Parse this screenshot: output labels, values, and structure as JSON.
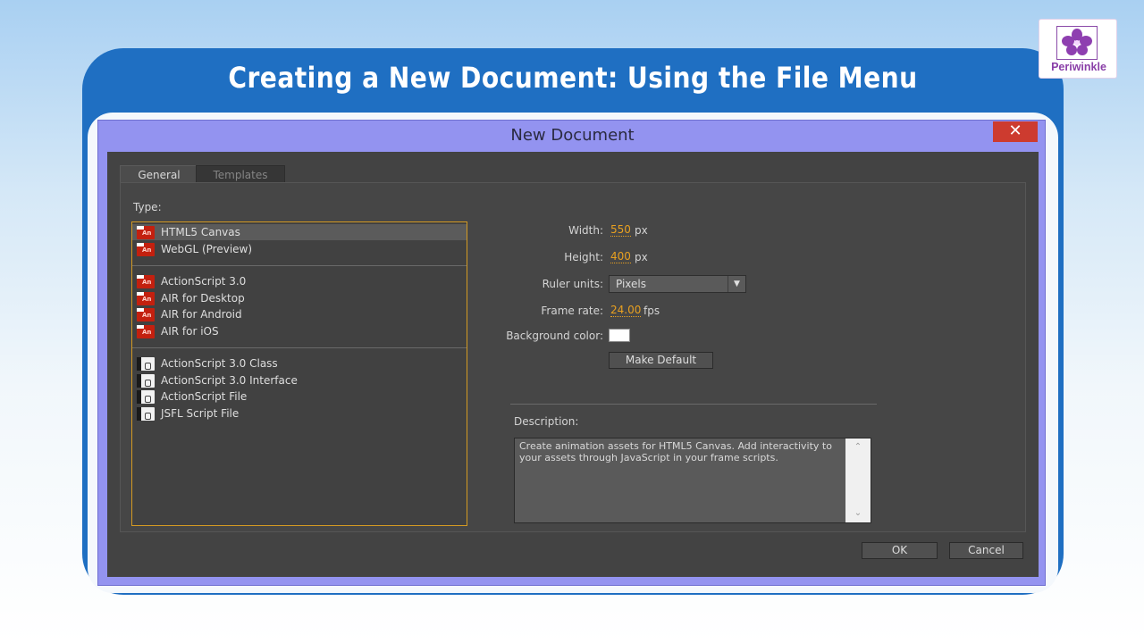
{
  "slide": {
    "title": "Creating a New Document: Using the File Menu",
    "logo_text": "Periwinkle"
  },
  "dialog": {
    "title": "New Document",
    "close_glyph": "✕",
    "tabs": [
      {
        "label": "General",
        "active": true
      },
      {
        "label": "Templates",
        "active": false
      }
    ],
    "type_label": "Type:",
    "types": [
      {
        "label": "HTML5 Canvas",
        "icon": "animate-doc-icon",
        "selected": true
      },
      {
        "label": "WebGL (Preview)",
        "icon": "animate-doc-icon"
      },
      {
        "label": "ActionScript 3.0",
        "icon": "animate-doc-icon"
      },
      {
        "label": "AIR for Desktop",
        "icon": "animate-doc-icon"
      },
      {
        "label": "AIR for Android",
        "icon": "animate-doc-icon"
      },
      {
        "label": "AIR for iOS",
        "icon": "animate-doc-icon"
      },
      {
        "label": "ActionScript 3.0 Class",
        "icon": "script-file-icon"
      },
      {
        "label": "ActionScript 3.0 Interface",
        "icon": "script-file-icon"
      },
      {
        "label": "ActionScript File",
        "icon": "script-file-icon"
      },
      {
        "label": "JSFL Script File",
        "icon": "script-file-icon"
      }
    ],
    "form": {
      "width_label": "Width:",
      "width_value": "550",
      "width_unit": "px",
      "height_label": "Height:",
      "height_value": "400",
      "height_unit": "px",
      "ruler_label": "Ruler units:",
      "ruler_value": "Pixels",
      "frame_rate_label": "Frame rate:",
      "frame_rate_value": "24.00",
      "frame_rate_unit": "fps",
      "bg_label": "Background color:",
      "bg_color": "#ffffff",
      "make_default": "Make Default"
    },
    "description_label": "Description:",
    "description_text": "Create animation assets for HTML5 Canvas. Add interactivity to your assets through JavaScript in your frame scripts.",
    "ok_label": "OK",
    "cancel_label": "Cancel"
  },
  "colors": {
    "accent_orange": "#e8a020",
    "slide_blue": "#1f6fc2",
    "dialog_frame": "#9393f0",
    "close_red": "#cd3b2f"
  }
}
